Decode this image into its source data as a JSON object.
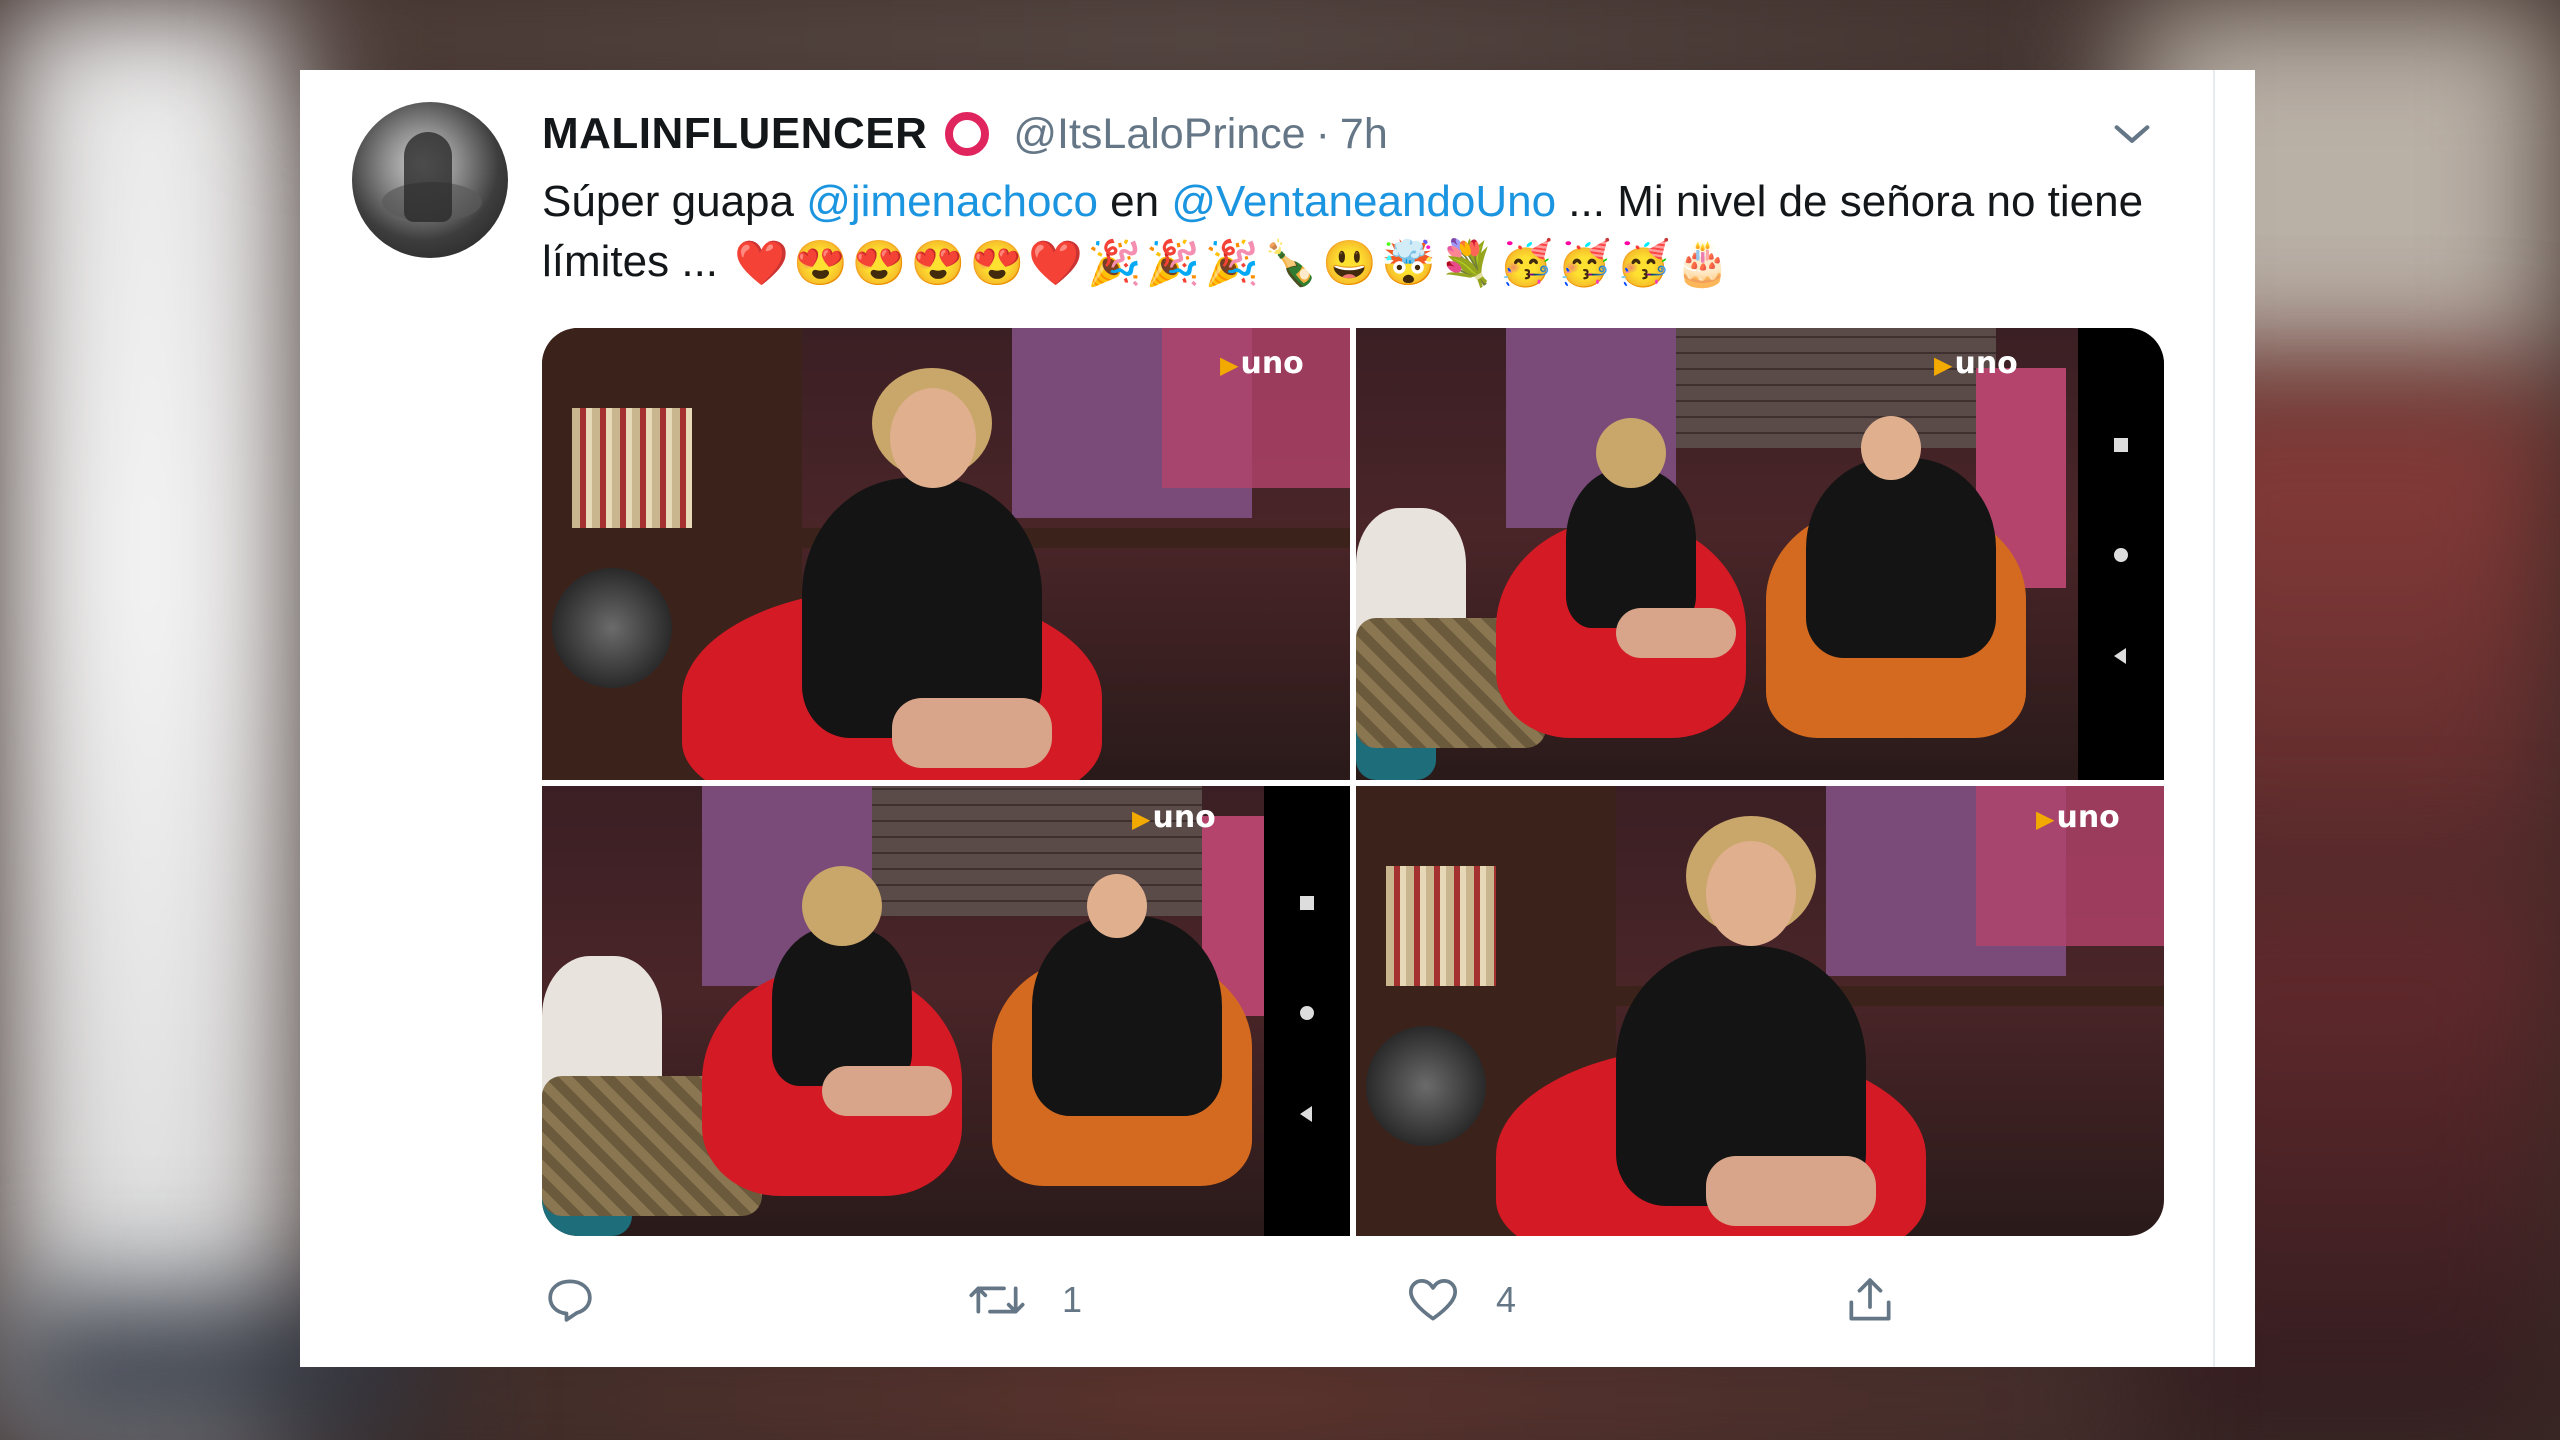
{
  "tweet": {
    "display_name": "MALINFLUENCER",
    "handle": "@ItsLaloPrince",
    "separator": "·",
    "time": "7h",
    "text_before": "Súper guapa ",
    "mention_1": "@jimenachoco",
    "text_middle": " en ",
    "mention_2": "@VentaneandoUno",
    "text_after": " ... Mi nivel de señora no tiene límites ... ",
    "emojis": [
      "❤️",
      "😍",
      "😍",
      "😍",
      "😍",
      "❤️",
      "🎉",
      "🎉",
      "🎉",
      "🍾",
      "😃",
      "🤯",
      "💐",
      "🥳",
      "🥳",
      "🥳",
      "🎂"
    ],
    "accent_color": "#1b95e0",
    "badge_color": "#e0245e"
  },
  "media": {
    "channel_logo": "uno",
    "tiles": [
      "photo-1",
      "photo-2",
      "photo-3",
      "photo-4"
    ]
  },
  "actions": {
    "reply_icon": "reply-icon",
    "retweet_icon": "retweet-icon",
    "retweet_count": "1",
    "like_icon": "heart-icon",
    "like_count": "4",
    "share_icon": "share-icon"
  }
}
